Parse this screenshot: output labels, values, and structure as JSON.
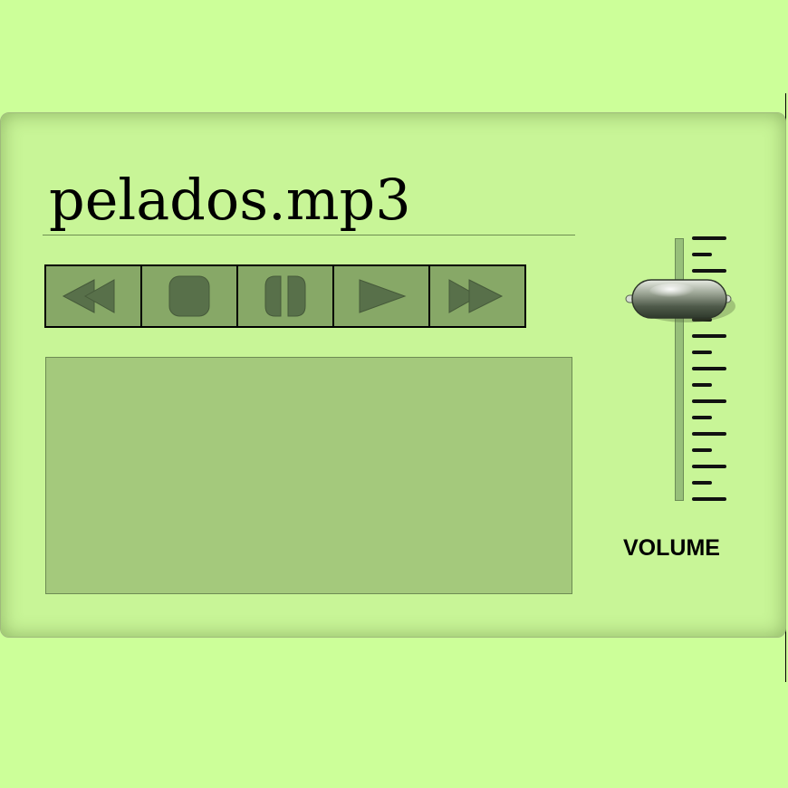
{
  "player": {
    "track_title": "pelados.mp3",
    "transport": [
      {
        "id": "rewind",
        "icon": "rewind-icon"
      },
      {
        "id": "stop",
        "icon": "stop-icon"
      },
      {
        "id": "pause",
        "icon": "pause-icon"
      },
      {
        "id": "play",
        "icon": "play-icon"
      },
      {
        "id": "fast-forward",
        "icon": "fast-forward-icon"
      }
    ],
    "volume": {
      "label": "VOLUME",
      "level": 0.79
    },
    "colors": {
      "background": "#ccff99",
      "panel": "#c8f597",
      "button_face": "#87a867",
      "icon": "#58704a",
      "display": "#a4c97c"
    }
  }
}
